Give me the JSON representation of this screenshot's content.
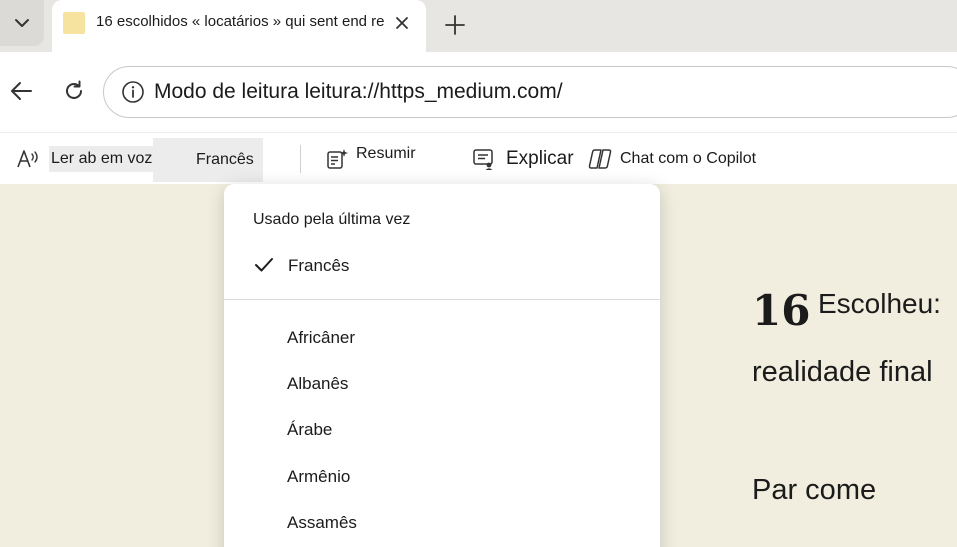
{
  "tab": {
    "title": "16 escolhidos « locatários » qui sent end re"
  },
  "address_bar": {
    "url": "Modo de leitura leitura://https_medium.com/"
  },
  "reader_toolbar": {
    "read_aloud": "Ler ab em voz alta",
    "language": "Francês",
    "summarize": "Resumir",
    "explain": "Explicar",
    "copilot_chat": "Chat com o Copilot"
  },
  "language_menu": {
    "header": "Usado pela última vez",
    "selected": "Francês",
    "items": [
      "Africâner",
      "Albanês",
      "Árabe",
      "Armênio",
      "Assamês"
    ]
  },
  "article": {
    "number": "16",
    "line1": "Escolheu:",
    "line2": "realidade final",
    "line3": "Par come"
  },
  "colors": {
    "tabstrip": "#e8e6e3",
    "reader_background": "#f1eedf",
    "favicon": "#f6e3a0"
  }
}
